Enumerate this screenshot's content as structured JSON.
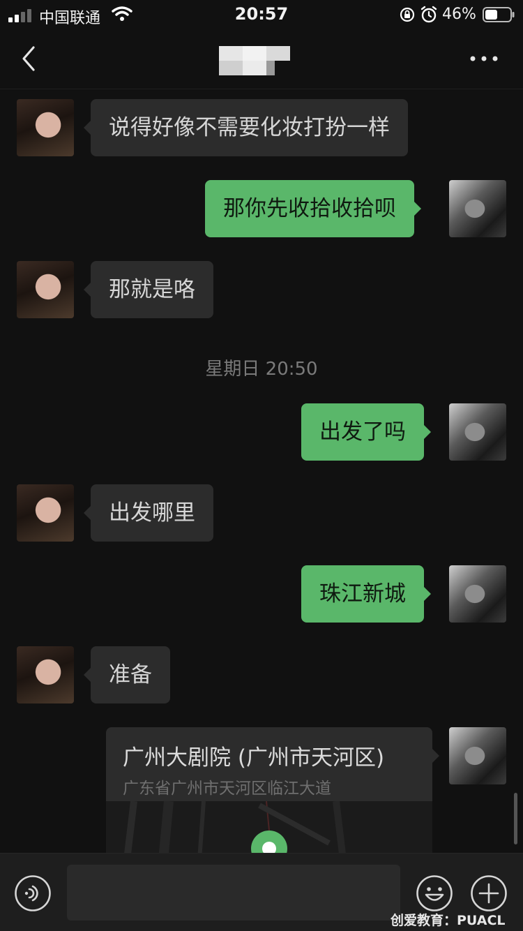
{
  "status_bar": {
    "carrier": "中国联通",
    "time": "20:57",
    "battery_pct": "46%"
  },
  "nav": {
    "back_icon": "chevron-left-icon",
    "more_icon": "more-dots-icon"
  },
  "messages": {
    "m1": "说得好像不需要化妆打扮一样",
    "m2": "那你先收拾收拾呗",
    "m3": "那就是咯",
    "timestamp": "星期日 20:50",
    "m4": "出发了吗",
    "m5": "出发哪里",
    "m6": "珠江新城",
    "m7": "准备"
  },
  "location": {
    "name": "广州大剧院 (广州市天河区)",
    "address": "广东省广州市天河区临江大道"
  },
  "input": {
    "value": "",
    "voice_icon": "voice-icon",
    "emoji_icon": "emoji-icon",
    "plus_icon": "plus-icon"
  },
  "watermark": "创爱教育：PUACL",
  "colors": {
    "background": "#111111",
    "sent_bubble": "#5ab76a",
    "received_bubble": "#2c2c2c",
    "timestamp_text": "#7a7a7a"
  }
}
